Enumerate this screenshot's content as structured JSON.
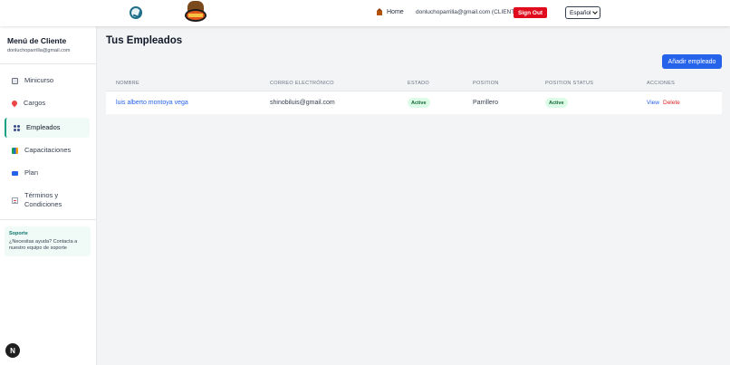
{
  "header": {
    "home_label": "Home",
    "user_email": "donluchoparrilla@gmail.com (CLIENT)",
    "signout_label": "Sign Out",
    "language_selected": "Español"
  },
  "sidebar": {
    "title": "Menú de Cliente",
    "email": "donluchoparrilla@gmail.com",
    "items": [
      {
        "label": "Minicurso",
        "icon": "book-icon"
      },
      {
        "label": "Cargos",
        "icon": "pin-icon"
      },
      {
        "label": "Empleados",
        "icon": "users-icon"
      },
      {
        "label": "Capacitaciones",
        "icon": "books-icon"
      },
      {
        "label": "Plan",
        "icon": "credit-card-icon"
      },
      {
        "label": "Términos y Condiciones",
        "icon": "document-icon"
      }
    ],
    "active_index": 2,
    "support": {
      "title": "Soporte",
      "text": "¿Necesitas ayuda? Contacta a nuestro equipo de soporte"
    }
  },
  "main": {
    "title": "Tus Empleados",
    "add_button": "Añadir empleado",
    "columns": [
      "NOMBRE",
      "CORREO ELECTRÓNICO",
      "ESTADO",
      "POSITION",
      "POSITION STATUS",
      "ACCIONES"
    ],
    "rows": [
      {
        "name": "luis alberto montoya vega",
        "email": "shinobiluis@gmail.com",
        "status": "Active",
        "position": "Parrillero",
        "position_status": "Active",
        "action_view": "View",
        "action_delete": "Delete"
      }
    ]
  },
  "dev_badge": "N",
  "colors": {
    "primary": "#2563eb",
    "accent": "#14a085",
    "danger": "#e00b1c"
  }
}
